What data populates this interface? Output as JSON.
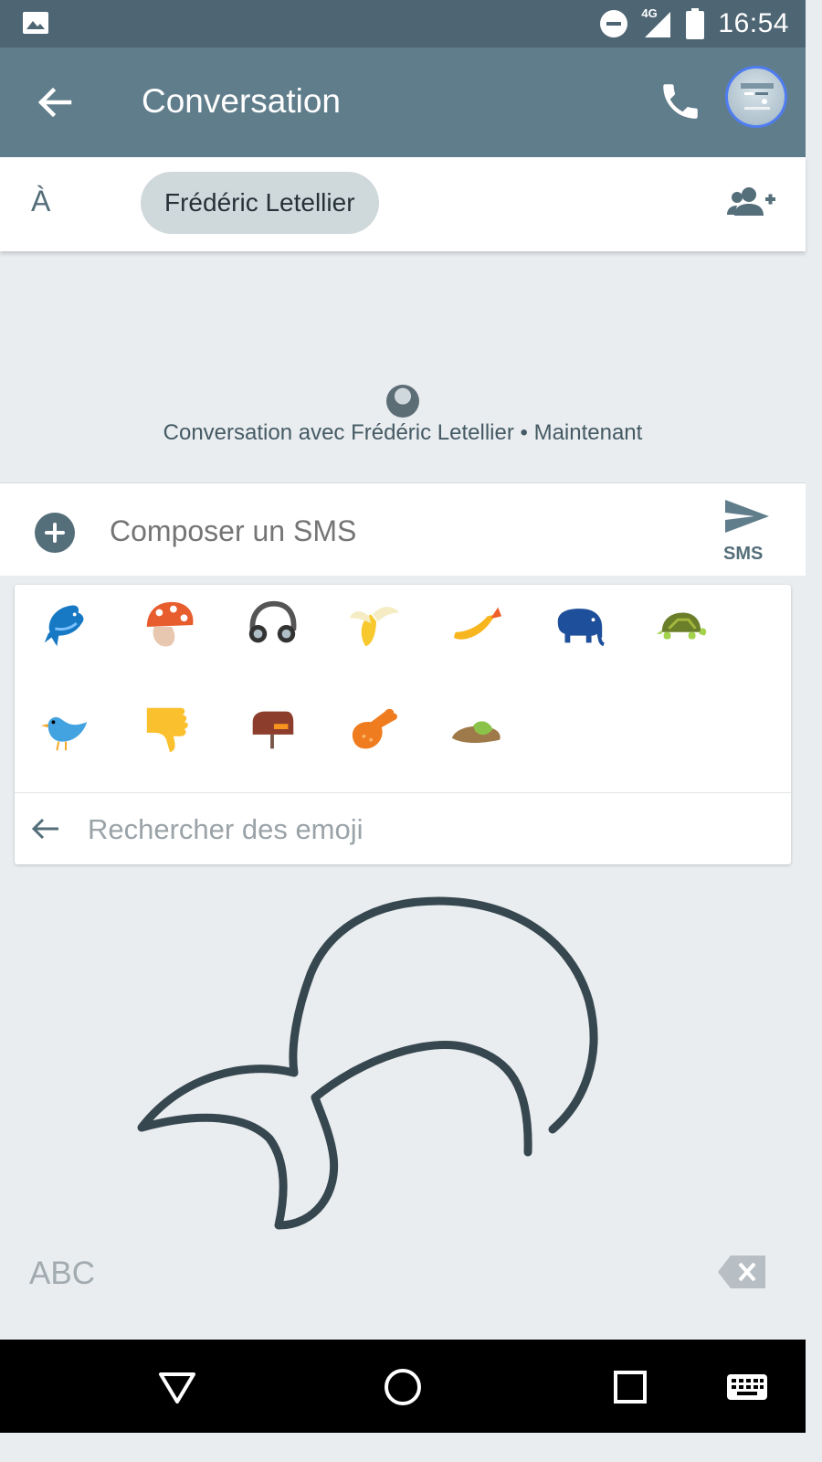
{
  "status_bar": {
    "time": "16:54",
    "network": "4G",
    "icons": [
      "image-icon",
      "do-not-disturb-icon",
      "signal-icon",
      "battery-icon"
    ]
  },
  "app_bar": {
    "title": "Conversation",
    "icons": [
      "back-arrow-icon",
      "phone-icon",
      "avatar"
    ]
  },
  "recipient": {
    "to_label": "À",
    "chip": "Frédéric Letellier",
    "add_icon": "add-person-icon"
  },
  "conversation": {
    "info": "Conversation avec Frédéric Letellier • Maintenant"
  },
  "compose": {
    "placeholder": "Composer un SMS",
    "send_label": "SMS"
  },
  "emoji": {
    "items": [
      "dolphin",
      "mushroom",
      "headphones",
      "banana",
      "fried-shrimp",
      "elephant",
      "turtle",
      "bird",
      "thumbs-down",
      "mailbox",
      "poultry-leg",
      "sandal"
    ],
    "search_placeholder": "Rechercher des emoji"
  },
  "keyboard": {
    "abc_label": "ABC"
  },
  "colors": {
    "status_bar": "#4e6574",
    "app_bar": "#607d8b",
    "chip": "#cfd9dc",
    "accent": "#546e7a",
    "ink": "#37474f"
  }
}
